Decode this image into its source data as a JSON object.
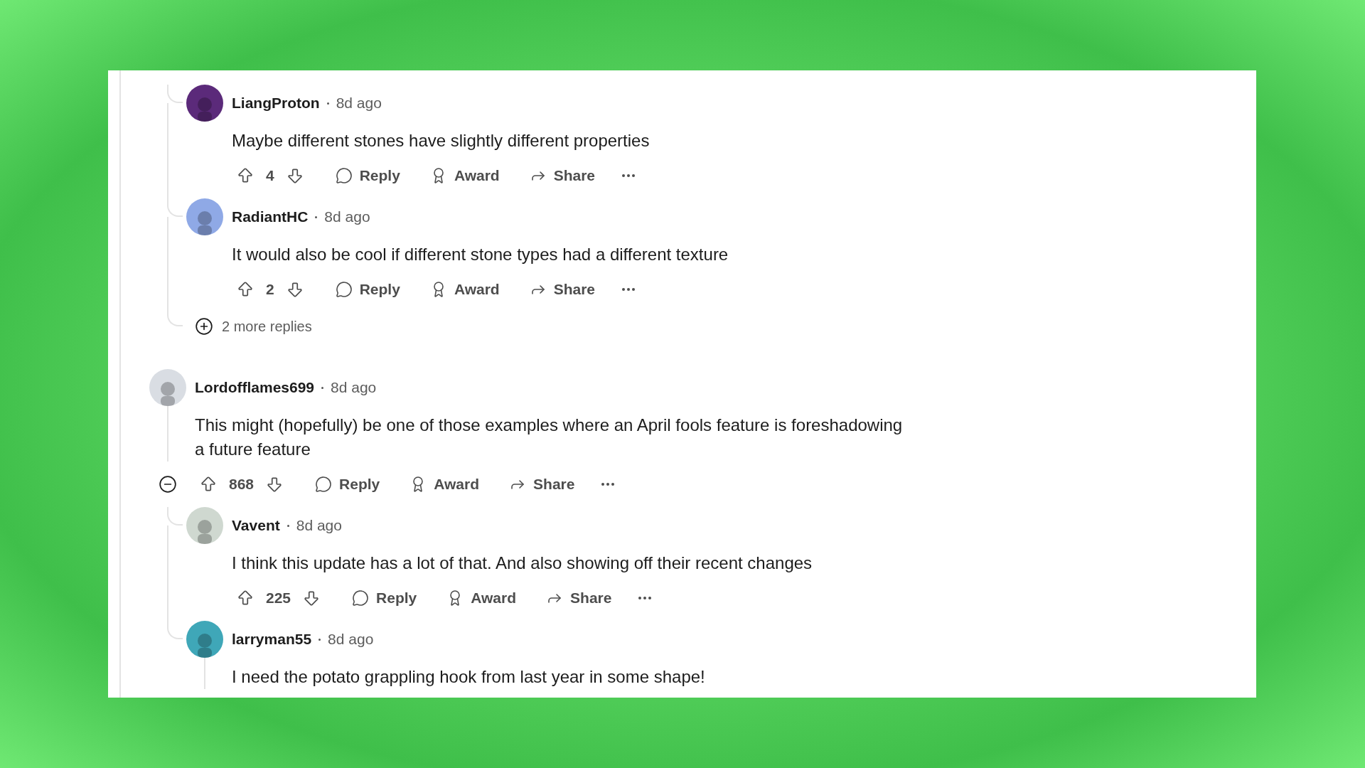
{
  "threads": [
    {
      "children": [
        {
          "user": "LiangProton",
          "time": "8d ago",
          "body": "Maybe different stones have slightly different properties",
          "votes": "4",
          "actions": [
            "Reply",
            "Award",
            "Share"
          ],
          "color": "#5b2a7a"
        },
        {
          "user": "RadiantHC",
          "time": "8d ago",
          "body": "It would also be cool if different stone types had a different texture",
          "votes": "2",
          "actions": [
            "Reply",
            "Award",
            "Share"
          ],
          "color": "#8fa9e6"
        }
      ],
      "more_replies": "2 more replies"
    },
    {
      "user": "Lordofflames699",
      "time": "8d ago",
      "body": "This might (hopefully) be one of those examples where an April fools feature is foreshadowing a future feature",
      "votes": "868",
      "actions": [
        "Reply",
        "Award",
        "Share"
      ],
      "color": "#d9dde3",
      "expanded": true,
      "children": [
        {
          "user": "Vavent",
          "time": "8d ago",
          "body": "I think this update has a lot of that. And also showing off their recent changes",
          "votes": "225",
          "actions": [
            "Reply",
            "Award",
            "Share"
          ],
          "color": "#cfd8d0"
        },
        {
          "user": "larryman55",
          "time": "8d ago",
          "body": "I need the potato grappling hook from last year in some shape!",
          "color": "#3fa7b8",
          "has_replies": true
        }
      ]
    }
  ]
}
